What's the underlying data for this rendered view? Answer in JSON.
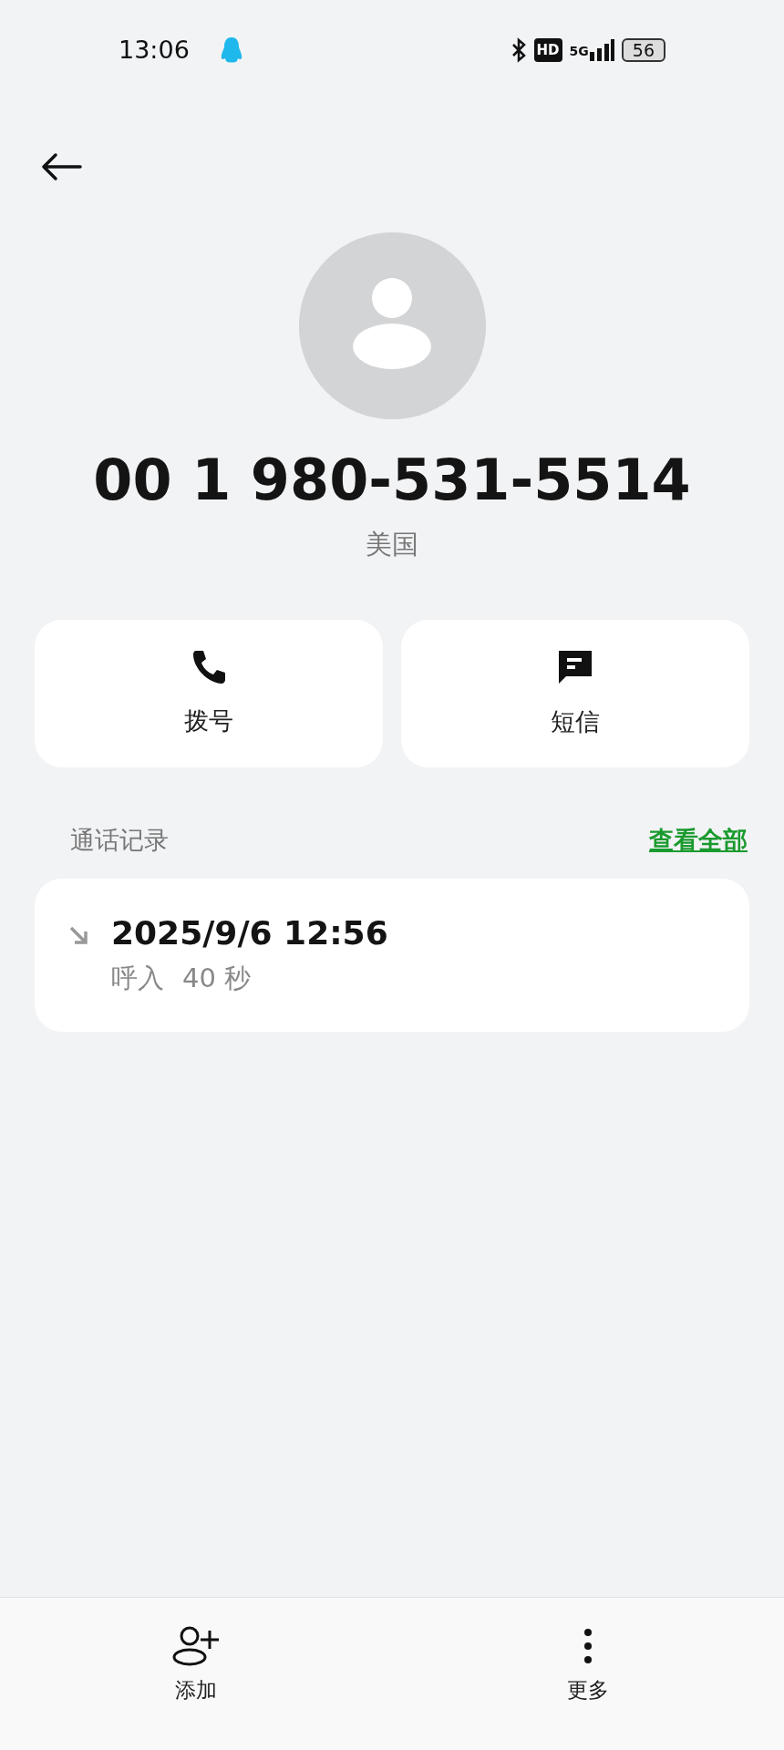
{
  "status_bar": {
    "time": "13:06",
    "hd_label": "HD",
    "network_label": "5G",
    "battery": "56"
  },
  "contact": {
    "number": "00 1 980-531-5514",
    "location": "美国"
  },
  "actions": [
    {
      "kind": "call",
      "label": "拨号"
    },
    {
      "kind": "message",
      "label": "短信"
    }
  ],
  "call_log": {
    "title": "通话记录",
    "view_all": "查看全部",
    "entries": [
      {
        "kind": "incoming",
        "datetime": "2025/9/6 12:56",
        "type": "呼入",
        "duration": "40 秒"
      }
    ]
  },
  "bottom_bar": [
    {
      "kind": "add",
      "label": "添加"
    },
    {
      "kind": "more",
      "label": "更多"
    }
  ]
}
